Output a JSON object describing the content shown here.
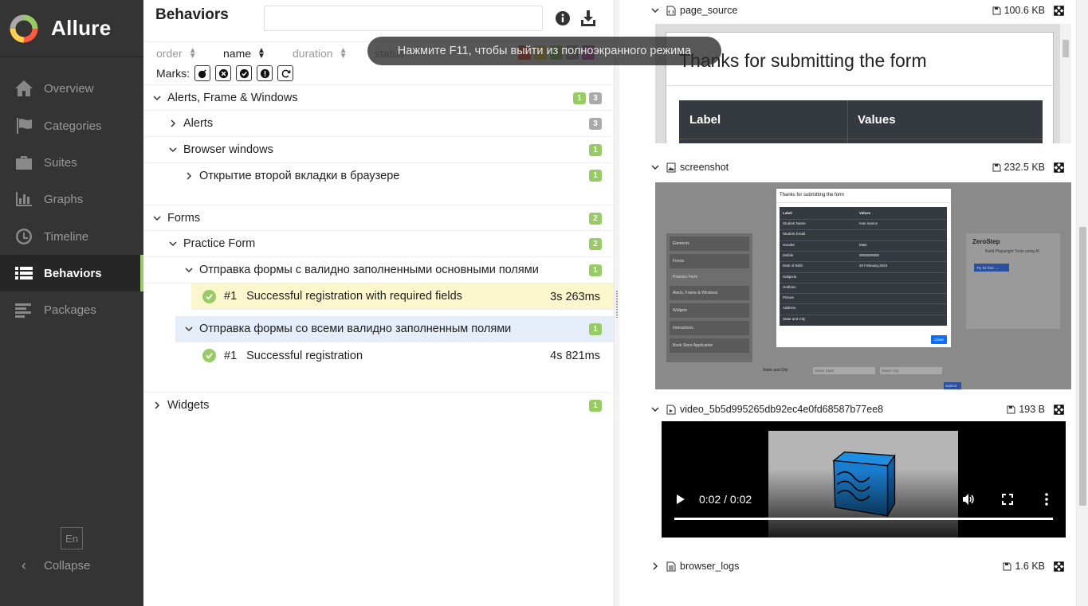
{
  "app": {
    "name": "Allure"
  },
  "sidebar": {
    "items": [
      {
        "label": "Overview",
        "icon": "home-icon"
      },
      {
        "label": "Categories",
        "icon": "flag-icon"
      },
      {
        "label": "Suites",
        "icon": "briefcase-icon"
      },
      {
        "label": "Graphs",
        "icon": "bar-chart-icon"
      },
      {
        "label": "Timeline",
        "icon": "clock-icon"
      },
      {
        "label": "Behaviors",
        "icon": "list-icon",
        "active": true
      },
      {
        "label": "Packages",
        "icon": "align-left-icon"
      }
    ],
    "language": "En",
    "collapse_label": "Collapse"
  },
  "behaviors": {
    "title": "Behaviors",
    "search": {
      "value": "",
      "placeholder": ""
    },
    "sorters": {
      "order": "order",
      "name": "name",
      "duration": "duration",
      "status": "status"
    },
    "marks_label": "Marks:",
    "tree": {
      "alerts_frame": {
        "label": "Alerts, Frame & Windows",
        "badges": [
          "1",
          "3"
        ]
      },
      "alerts": {
        "label": "Alerts",
        "badges": [
          "3"
        ]
      },
      "browser_windows": {
        "label": "Browser windows",
        "badges": [
          "1"
        ]
      },
      "new_tab": {
        "label": "Открытие второй вкладки в браузере",
        "badges": [
          "1"
        ]
      },
      "forms": {
        "label": "Forms",
        "badges": [
          "2"
        ]
      },
      "practice_form": {
        "label": "Practice Form",
        "badges": [
          "2"
        ]
      },
      "story_required": {
        "label": "Отправка формы с валидно заполненными основными полями",
        "badges": [
          "1"
        ]
      },
      "test_required": {
        "number": "#1",
        "label": "Successful registration with required fields",
        "duration": "3s 263ms"
      },
      "story_all": {
        "label": "Отправка формы со всеми валидно заполненным полями",
        "badges": [
          "1"
        ]
      },
      "test_all": {
        "number": "#1",
        "label": "Successful registration",
        "duration": "4s 821ms"
      },
      "widgets": {
        "label": "Widgets",
        "badges": [
          "1"
        ]
      }
    }
  },
  "attachments": {
    "page_source": {
      "name": "page_source",
      "size": "100.6 KB",
      "heading": "Thanks for submitting the form",
      "col_label": "Label",
      "col_values": "Values"
    },
    "screenshot": {
      "name": "screenshot",
      "size": "232.5 KB",
      "modal_title": "Thanks for submitting the form",
      "modal_cols": [
        "Label",
        "Values"
      ],
      "modal_rows": [
        [
          "Student Name",
          "Ivan Ivanov"
        ],
        [
          "Student Email",
          ""
        ],
        [
          "Gender",
          "Male"
        ],
        [
          "Mobile",
          "0000000000"
        ],
        [
          "Date of Birth",
          "20 February,2024"
        ],
        [
          "Subjects",
          ""
        ],
        [
          "Hobbies",
          ""
        ],
        [
          "Picture",
          ""
        ],
        [
          "Address",
          ""
        ],
        [
          "State and City",
          ""
        ]
      ],
      "close_label": "Close",
      "bg_menu": [
        "Elements",
        "Forms",
        "Practice Form",
        "Alerts, Frame & Windows",
        "Widgets",
        "Interactions",
        "Book Store Application"
      ],
      "bg_brand": "ZeroStep",
      "bg_ad_title": "Build Playwright Tests using AI",
      "bg_ad_btn": "Try for free →",
      "bg_state_label": "State and City",
      "bg_state_ph": "Select State",
      "bg_city_ph": "Select City",
      "bg_submit": "Submit"
    },
    "video": {
      "name": "video_5b5d995265db92ec4e0fd68587b77ee8",
      "size": "193 B",
      "time": "0:02 / 0:02",
      "progress": 1.0
    },
    "browser_logs": {
      "name": "browser_logs",
      "size": "1.6 KB"
    }
  },
  "toast": {
    "text": "Нажмите F11, чтобы выйти из полноэкранного режима"
  },
  "colors": {
    "sidebar_bg": "#343434",
    "accent_green": "#97cc64",
    "badge_gray": "#aaaaaa",
    "highlight_yellow": "#fcf6cd",
    "highlight_blue": "#e4edf8",
    "table_dark": "#343a40"
  }
}
